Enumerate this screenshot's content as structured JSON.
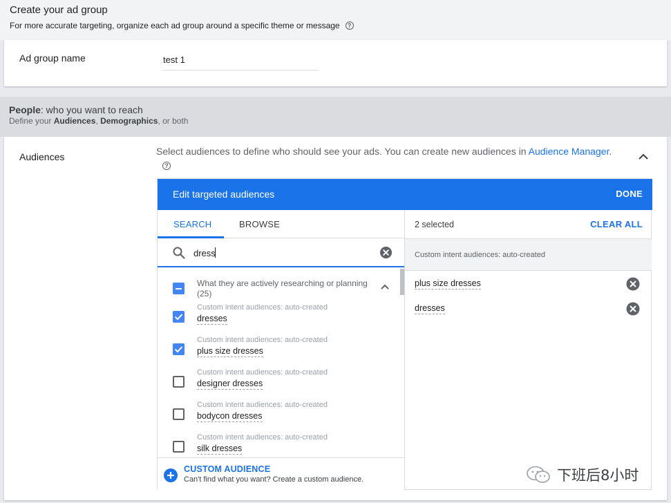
{
  "header": {
    "title": "Create your ad group",
    "subtitle": "For more accurate targeting, organize each ad group around a specific theme or message"
  },
  "ad_group": {
    "label": "Ad group name",
    "value": "test 1"
  },
  "people": {
    "title_bold": "People",
    "title_rest": ": who you want to reach",
    "sub_pre": "Define your ",
    "sub_bold1": "Audiences",
    "sub_mid": ", ",
    "sub_bold2": "Demographics",
    "sub_post": ", or both"
  },
  "audiences": {
    "label": "Audiences",
    "description": "Select audiences to define who should see your ads.  You can create new audiences in ",
    "link": "Audience Manager",
    "link_suffix": "."
  },
  "editor": {
    "title": "Edit targeted audiences",
    "done": "DONE",
    "tabs": [
      {
        "label": "SEARCH",
        "active": true
      },
      {
        "label": "BROWSE",
        "active": false
      }
    ],
    "search_value": "dress",
    "group": {
      "label": "What they are actively researching or planning",
      "count": "(25)",
      "state": "indeterminate"
    },
    "results": [
      {
        "category": "Custom intent audiences: auto-created",
        "name": "dresses",
        "checked": true
      },
      {
        "category": "Custom intent audiences: auto-created",
        "name": "plus size dresses",
        "checked": true
      },
      {
        "category": "Custom intent audiences: auto-created",
        "name": "designer dresses",
        "checked": false
      },
      {
        "category": "Custom intent audiences: auto-created",
        "name": "bodycon dresses",
        "checked": false
      },
      {
        "category": "Custom intent audiences: auto-created",
        "name": "silk dresses",
        "checked": false
      }
    ],
    "custom_audience": {
      "label": "CUSTOM AUDIENCE",
      "sub": "Can't find what you want? Create a custom audience."
    }
  },
  "selected": {
    "count_label": "2 selected",
    "clear_all": "CLEAR ALL",
    "group_label": "Custom intent audiences: auto-created",
    "items": [
      "plus size dresses",
      "dresses"
    ]
  },
  "watermark": {
    "text": "下班后8小时"
  },
  "colors": {
    "accent": "#1a73e8",
    "checkbox": "#4285f4"
  }
}
